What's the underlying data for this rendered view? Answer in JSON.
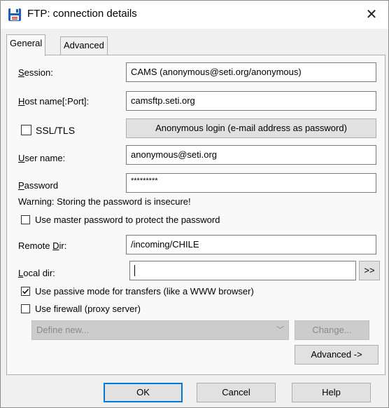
{
  "window": {
    "title": "FTP: connection details",
    "close_glyph": "✕"
  },
  "tabs": [
    {
      "label": "General",
      "active": true
    },
    {
      "label": "Advanced",
      "active": false
    }
  ],
  "form": {
    "session": {
      "label_first": "S",
      "label_rest": "ession:",
      "value": "CAMS (anonymous@seti.org/anonymous)"
    },
    "host": {
      "label_first": "H",
      "label_rest": "ost name[:Port]:",
      "value": "camsftp.seti.org"
    },
    "ssl": {
      "label": "SSL/TLS",
      "checked": false
    },
    "anonymous_button": "Anonymous login (e-mail address as password)",
    "user": {
      "label_first": "U",
      "label_rest": "ser name:",
      "value": "anonymous@seti.org"
    },
    "password": {
      "label_first": "P",
      "label_rest": "assword",
      "value": "*********"
    },
    "warning": "Warning: Storing the password is insecure!",
    "master_password": {
      "label": "Use master password to protect the password",
      "checked": false
    },
    "remote_dir": {
      "label_pre": "Remote ",
      "label_u": "D",
      "label_rest": "ir:",
      "value": "/incoming/CHILE"
    },
    "local_dir": {
      "label_first": "L",
      "label_rest": "ocal dir:",
      "value": "",
      "browse": ">>"
    },
    "passive_mode": {
      "label": "Use passive mode for transfers (like a WWW browser)",
      "checked": true
    },
    "firewall": {
      "label": "Use firewall (proxy server)",
      "checked": false
    },
    "firewall_select": {
      "value": "Define new..."
    },
    "change_button": "Change...",
    "advanced_button": "Advanced ->"
  },
  "footer": {
    "ok": "OK",
    "cancel": "Cancel",
    "help": "Help"
  },
  "colors": {
    "accent": "#0078d7",
    "icon_blue": "#1f5fb8",
    "icon_red": "#c0392b"
  }
}
